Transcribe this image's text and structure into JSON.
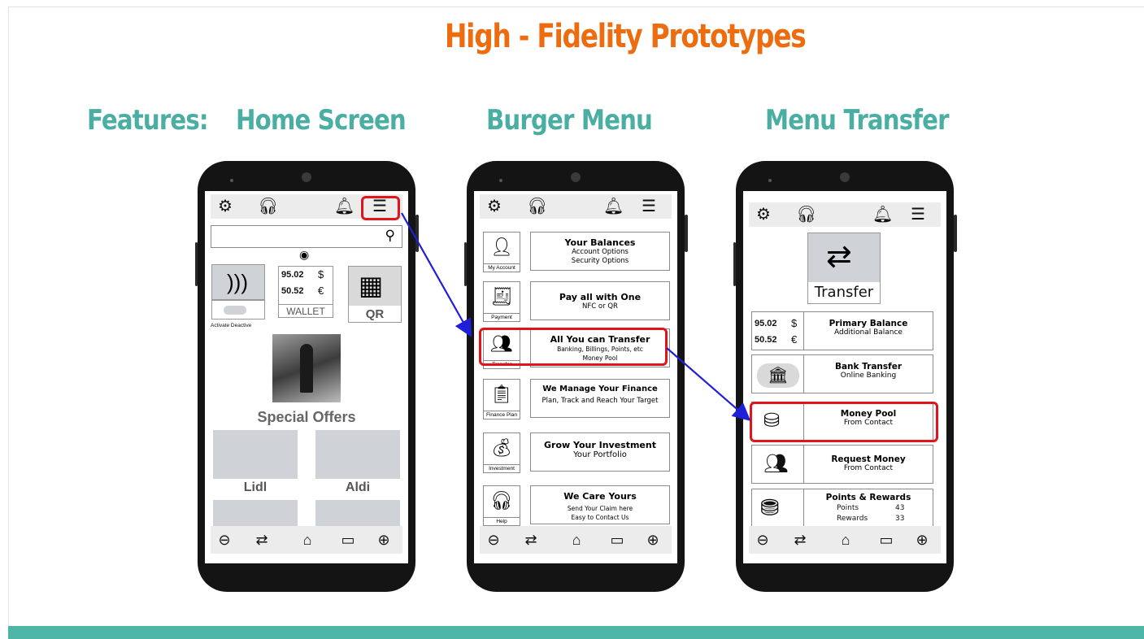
{
  "title": "High - Fidelity Prototypes",
  "labels": {
    "features": "Features:",
    "home": "Home Screen",
    "burger": "Burger Menu",
    "transfer": "Menu Transfer"
  },
  "colors": {
    "title": "#ec6c0f",
    "label": "#4aaea2",
    "highlight": "#e0141a",
    "arrow": "#1f1fd8",
    "footer": "#4db6a6"
  },
  "topbar_icons": [
    "gear-icon",
    "headset-icon",
    "bell-icon",
    "hamburger-icon"
  ],
  "bottombar_icons": [
    "back-icon",
    "transfer-icon",
    "home-icon",
    "wallet-icon",
    "forward-icon"
  ],
  "home": {
    "balance1": "95.02",
    "balance2": "50.52",
    "wallet_label": "WALLET",
    "qr_label": "QR",
    "nfc_caption": "Activate  Deactive",
    "special_offers": "Special Offers",
    "offer1": "Lidl",
    "offer2": "Aldi"
  },
  "burger": {
    "items": [
      {
        "icon_caption": "My Account",
        "title": "Your Balances",
        "lines": [
          "Account Options",
          "Security Options"
        ]
      },
      {
        "icon_caption": "Payment",
        "title": "Pay all with One",
        "lines": [
          "NFC or QR"
        ]
      },
      {
        "icon_caption": "Transfer",
        "title": "All You can Transfer",
        "lines": [
          "Banking, Billings, Points, etc",
          "Money Pool"
        ]
      },
      {
        "icon_caption": "Finance Plan",
        "title": "We Manage Your Finance",
        "lines": [
          "Plan, Track and Reach Your Target"
        ]
      },
      {
        "icon_caption": "Investment",
        "title": "Grow Your Investment",
        "lines": [
          "Your Portfolio"
        ]
      },
      {
        "icon_caption": "Help",
        "title": "We Care Yours",
        "lines": [
          "Send Your Claim here",
          "Easy to Contact Us"
        ]
      }
    ]
  },
  "transfer": {
    "header": "Transfer",
    "balance1": "95.02",
    "balance2": "50.52",
    "rows": [
      {
        "title": "Primary Balance",
        "sub": "Additional Balance"
      },
      {
        "title": "Bank Transfer",
        "sub": "Online Banking"
      },
      {
        "title": "Money Pool",
        "sub": "From Contact"
      },
      {
        "title": "Request Money",
        "sub": "From Contact"
      },
      {
        "title": "Points & Rewards",
        "points_label": "Points",
        "points": "43",
        "rewards_label": "Rewards",
        "rewards": "33"
      }
    ]
  }
}
